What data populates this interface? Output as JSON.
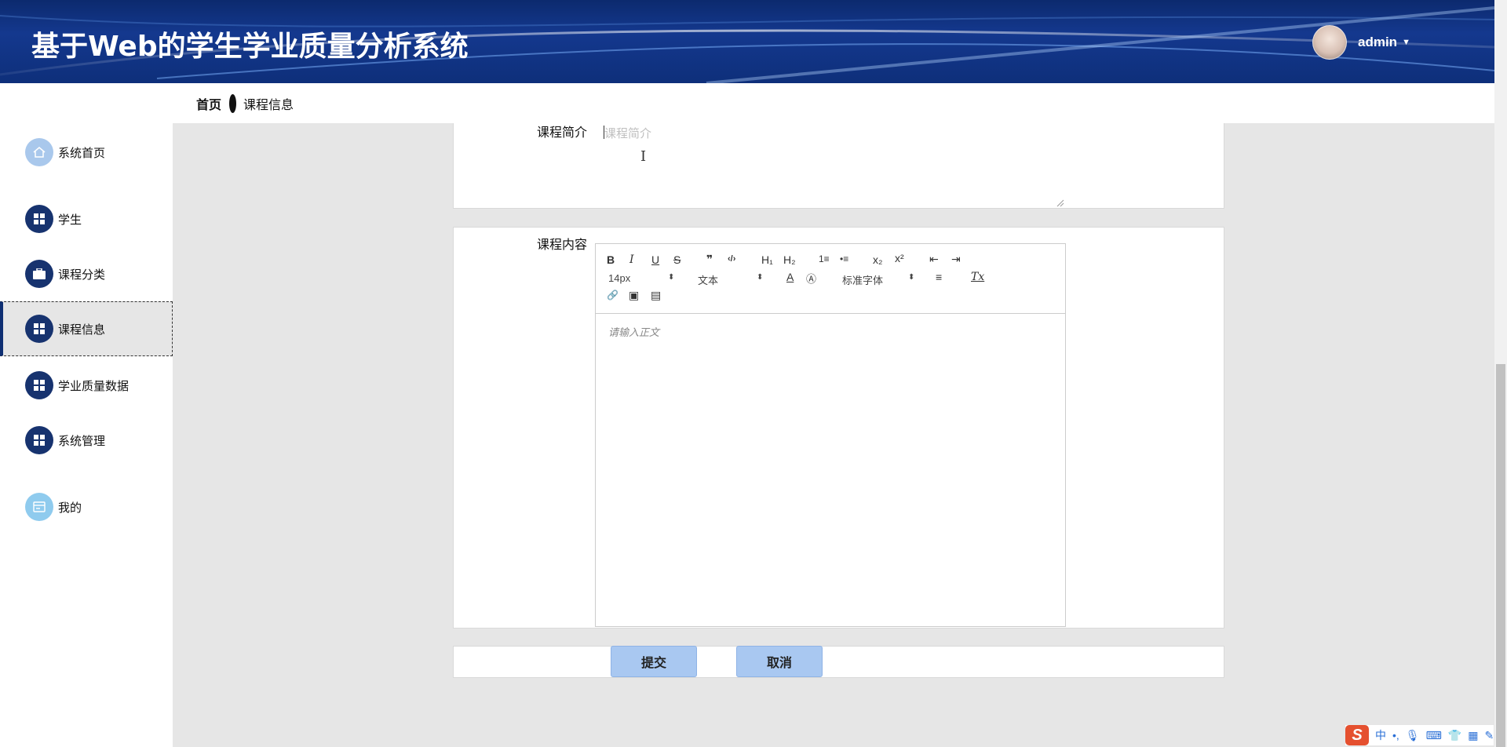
{
  "app": {
    "title": "基于Web的学生学业质量分析系统",
    "user": "admin"
  },
  "breadcrumb": {
    "home": "首页",
    "current": "课程信息"
  },
  "sidebar": {
    "items": [
      {
        "label": "系统首页",
        "icon": "home-icon"
      },
      {
        "label": "学生",
        "icon": "grid-icon"
      },
      {
        "label": "课程分类",
        "icon": "briefcase-icon"
      },
      {
        "label": "课程信息",
        "icon": "grid-icon",
        "active": true
      },
      {
        "label": "学业质量数据",
        "icon": "grid-icon"
      },
      {
        "label": "系统管理",
        "icon": "grid-icon"
      },
      {
        "label": "我的",
        "icon": "card-icon"
      }
    ]
  },
  "form": {
    "intro_label": "课程简介",
    "intro_placeholder": "课程简介",
    "content_label": "课程内容",
    "editor": {
      "font_size": "14px",
      "block_format": "文本",
      "font_family": "标准字体",
      "placeholder": "请输入正文",
      "toolbar": {
        "bold": "B",
        "italic": "I",
        "underline": "U",
        "strike": "S",
        "quote": "❞",
        "code": "‹/›",
        "h1": "H₁",
        "h2": "H₂",
        "ordered_list": "1≡",
        "bullet_list": "•≡",
        "subscript": "x₂",
        "superscript": "x²",
        "outdent": "⇤",
        "indent": "⇥",
        "color": "A",
        "background": "Ⓐ",
        "align": "≡",
        "clean": "Tx",
        "link": "🔗",
        "image": "▣",
        "video": "▤"
      }
    },
    "submit": "提交",
    "cancel": "取消"
  },
  "ime": {
    "logo": "S",
    "lang": "中"
  }
}
